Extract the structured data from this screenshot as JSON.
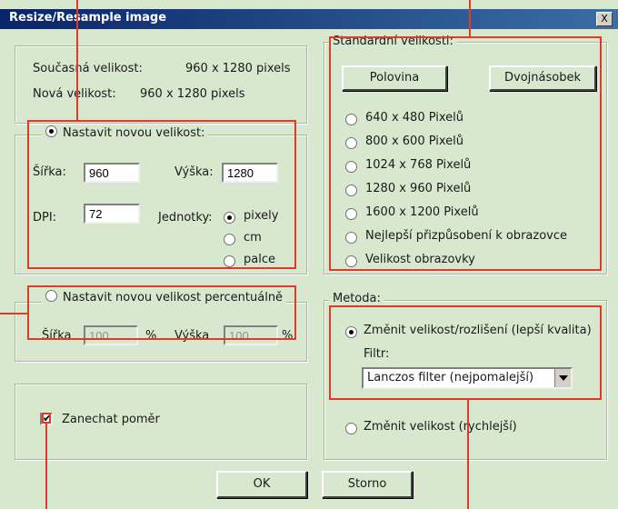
{
  "window": {
    "title": "Resize/Resample image",
    "close_label": "X"
  },
  "info": {
    "current_label": "Současná velikost:",
    "current_value": "960  x  1280  pixels",
    "new_label": "Nová velikost:",
    "new_value": "960  x  1280  pixels"
  },
  "new_size": {
    "legend": "Nastavit novou velikost:",
    "selected": true,
    "width_label": "Šířka:",
    "width_value": "960",
    "height_label": "Výška:",
    "height_value": "1280",
    "dpi_label": "DPI:",
    "dpi_value": "72",
    "units_label": "Jednotky:",
    "units": [
      {
        "label": "pixely",
        "selected": true
      },
      {
        "label": "cm",
        "selected": false
      },
      {
        "label": "palce",
        "selected": false
      }
    ]
  },
  "percent": {
    "legend": "Nastavit novou velikost percentuálně",
    "selected": false,
    "width_label": "Šířka",
    "width_value": "100",
    "height_label": "Výška",
    "height_value": "100",
    "unit": "%"
  },
  "keep_ratio": {
    "label": "Zanechat poměr",
    "checked": true
  },
  "standard": {
    "legend": "Standardní velikosti:",
    "half_button": "Polovina",
    "double_button": "Dvojnásobek",
    "options": [
      "640 x 480 Pixelů",
      "800 x 600 Pixelů",
      "1024 x 768 Pixelů",
      "1280 x 960 Pixelů",
      "1600 x 1200 Pixelů",
      "Nejlepší přizpůsobení k obrazovce",
      "Velikost obrazovky"
    ]
  },
  "method": {
    "legend": "Metoda:",
    "resample_label": "Změnit velikost/rozlišení (lepší kvalita)",
    "resample_selected": true,
    "filter_label": "Filtr:",
    "filter_value": "Lanczos filter (nejpomalejší)",
    "resize_label": "Změnit velikost (rychlejší)",
    "resize_selected": false
  },
  "buttons": {
    "ok": "OK",
    "cancel": "Storno"
  },
  "colors": {
    "highlight": "#e23a28",
    "titlebar": "#0a246a",
    "background": "#d8e8cf"
  }
}
